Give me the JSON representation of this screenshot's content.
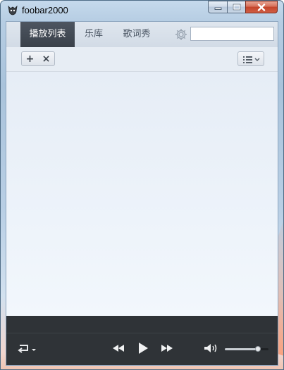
{
  "window": {
    "title": "foobar2000",
    "icon": "foobar-app-icon"
  },
  "tabs": [
    {
      "label": "播放列表",
      "active": true
    },
    {
      "label": "乐库",
      "active": false
    },
    {
      "label": "歌词秀",
      "active": false
    }
  ],
  "search": {
    "value": "",
    "placeholder": ""
  },
  "toolbar": {
    "add_label": "+",
    "remove_label": "×",
    "view_icon": "list-view-icon"
  },
  "player": {
    "repeat_icon": "repeat-icon",
    "prev_icon": "previous-icon",
    "play_icon": "play-icon",
    "next_icon": "next-icon",
    "volume_icon": "volume-icon",
    "volume_level": 0.75
  },
  "colors": {
    "active_tab": "#3a414a",
    "player_bar": "#2f3337"
  }
}
